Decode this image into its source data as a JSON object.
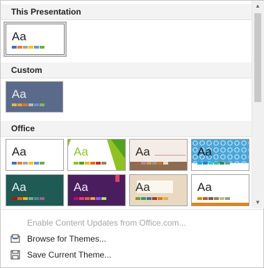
{
  "sections": {
    "this_presentation": "This Presentation",
    "custom": "Custom",
    "office": "Office"
  },
  "thumb_text": "Aa",
  "menu": {
    "enable_updates": "Enable Content Updates from Office.com...",
    "browse": "Browse for Themes...",
    "save": "Save Current Theme..."
  },
  "icons": {
    "scroll_up": "scroll-up-icon",
    "scroll_down": "scroll-down-icon",
    "browse": "folder-icon",
    "save": "save-icon"
  },
  "palettes": {
    "office": [
      "#4472c4",
      "#ed7d31",
      "#a5a5a5",
      "#ffc000",
      "#5b9bd5",
      "#70ad47"
    ],
    "custom": [
      "#e8b64d",
      "#f39c24",
      "#d47c2e",
      "#b9b9b9",
      "#6f92c8",
      "#8bb95a"
    ],
    "facet": [
      "#90c226",
      "#54a021",
      "#e6b91e",
      "#e76618",
      "#c42f1a",
      "#918655"
    ],
    "wood": [
      "#a5644e",
      "#b58b80",
      "#c3986d",
      "#a19574",
      "#c17529",
      "#e8dcc5"
    ],
    "circuit": [
      "#1cade4",
      "#2683c6",
      "#27ced7",
      "#42ba97",
      "#3e8853",
      "#62a39f"
    ],
    "ion": [
      "#b01513",
      "#ea6312",
      "#e6b729",
      "#6aac90",
      "#54849a",
      "#9e5e9b"
    ],
    "ion_boardroom": [
      "#b31166",
      "#e33d6f",
      "#e45f3c",
      "#e9a23b",
      "#9955ff",
      "#a7ea52"
    ],
    "organic": [
      "#83992a",
      "#3c9770",
      "#44709d",
      "#a23c33",
      "#d97828",
      "#deb340"
    ],
    "retrospect": [
      "#e48312",
      "#bd582c",
      "#865640",
      "#9b8357",
      "#c2bc80",
      "#94a088"
    ]
  }
}
